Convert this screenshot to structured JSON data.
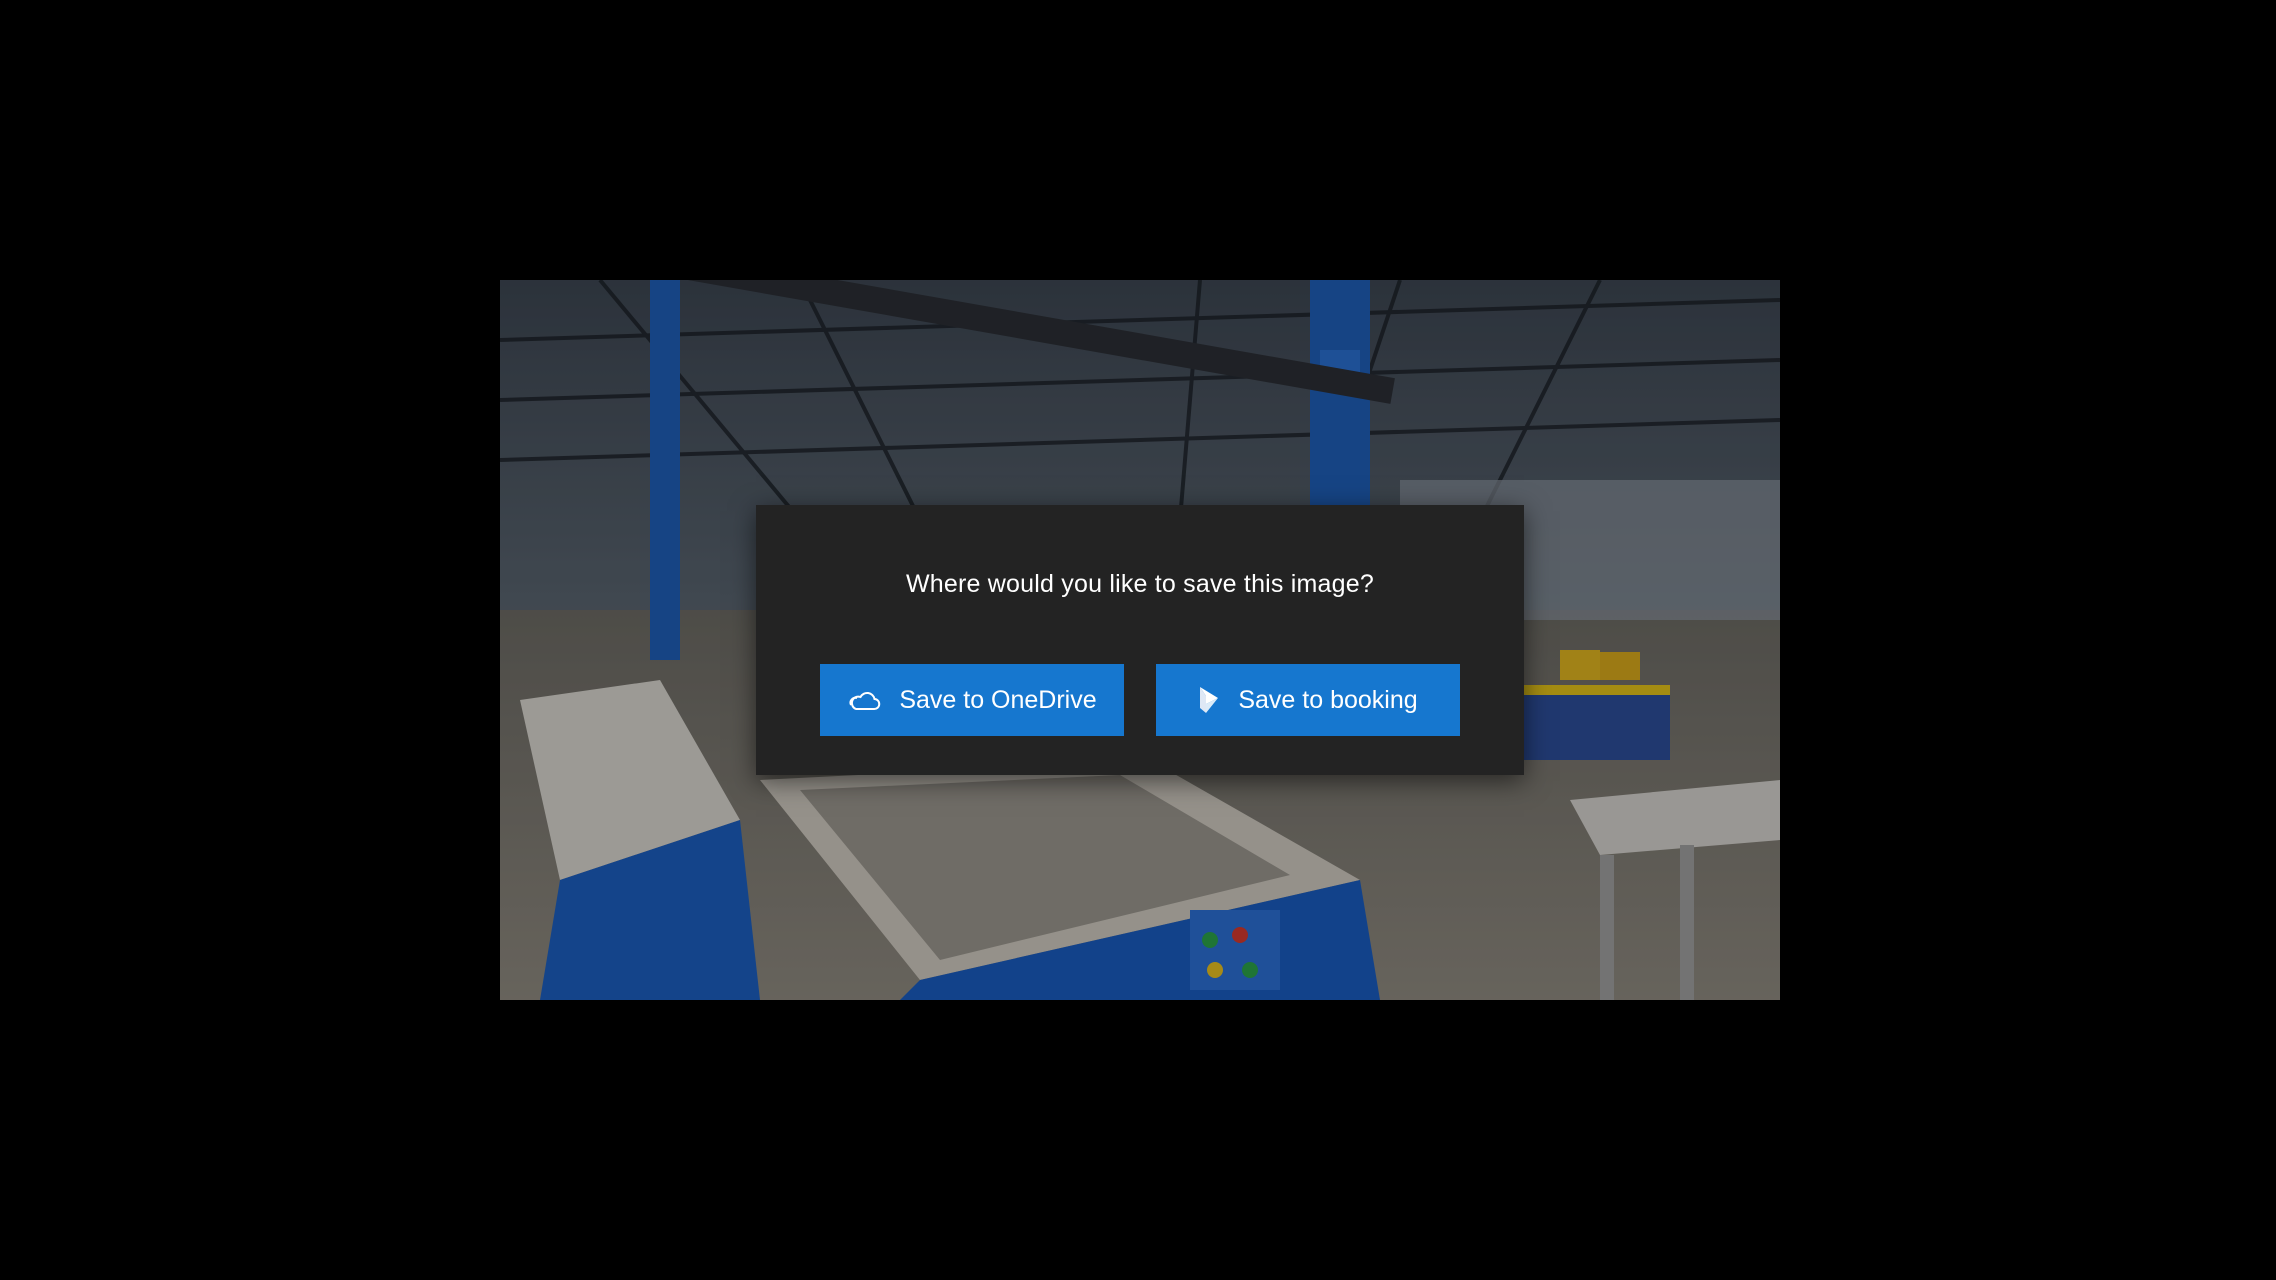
{
  "dialog": {
    "title": "Where would you like to save this image?",
    "buttons": [
      {
        "label": "Save to OneDrive",
        "icon": "onedrive-cloud-icon"
      },
      {
        "label": "Save to booking",
        "icon": "dynamics-booking-icon"
      }
    ]
  },
  "colors": {
    "background": "#000000",
    "dialog_background": "#232323",
    "button_background": "#1677cf",
    "text": "#ffffff"
  }
}
